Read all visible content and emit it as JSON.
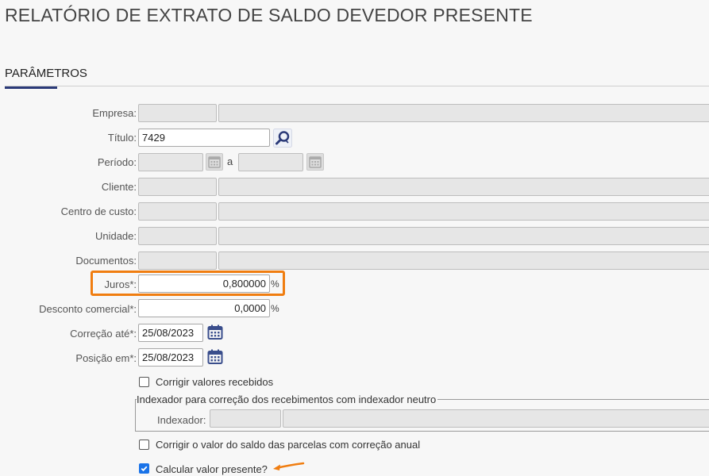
{
  "page": {
    "title": "RELATÓRIO DE EXTRATO DE SALDO DEVEDOR PRESENTE"
  },
  "section": {
    "title": "PARÂMETROS"
  },
  "fields": {
    "empresa": {
      "label": "Empresa:"
    },
    "titulo": {
      "label": "Título:",
      "value": "7429"
    },
    "periodo": {
      "label": "Período:",
      "separator": "a"
    },
    "cliente": {
      "label": "Cliente:"
    },
    "centro_custo": {
      "label": "Centro de custo:"
    },
    "unidade": {
      "label": "Unidade:"
    },
    "documentos": {
      "label": "Documentos:"
    },
    "juros": {
      "label": "Juros*:",
      "value": "0,800000",
      "unit": "%"
    },
    "desconto": {
      "label": "Desconto comercial*:",
      "value": "0,0000",
      "unit": "%"
    },
    "correcao": {
      "label": "Correção até*:",
      "value": "25/08/2023"
    },
    "posicao": {
      "label": "Posição em*:",
      "value": "25/08/2023"
    }
  },
  "checkboxes": {
    "corrigir_recebidos": {
      "label": "Corrigir valores recebidos",
      "checked": false
    },
    "corrigir_saldo": {
      "label": "Corrigir o valor do saldo das parcelas com correção anual",
      "checked": false
    },
    "calcular_presente": {
      "label": "Calcular valor presente?",
      "checked": true
    }
  },
  "indexador_group": {
    "legend": "Indexador para correção dos recebimentos com indexador neutro",
    "label": "Indexador:"
  },
  "colors": {
    "highlight": "#f07d10",
    "accent": "#2b3a78",
    "checkbox": "#1a73e8",
    "icon": "#3a4e8c"
  },
  "icons": {
    "search": "search-icon",
    "calendar": "calendar-icon",
    "arrow": "arrow-left-icon"
  }
}
